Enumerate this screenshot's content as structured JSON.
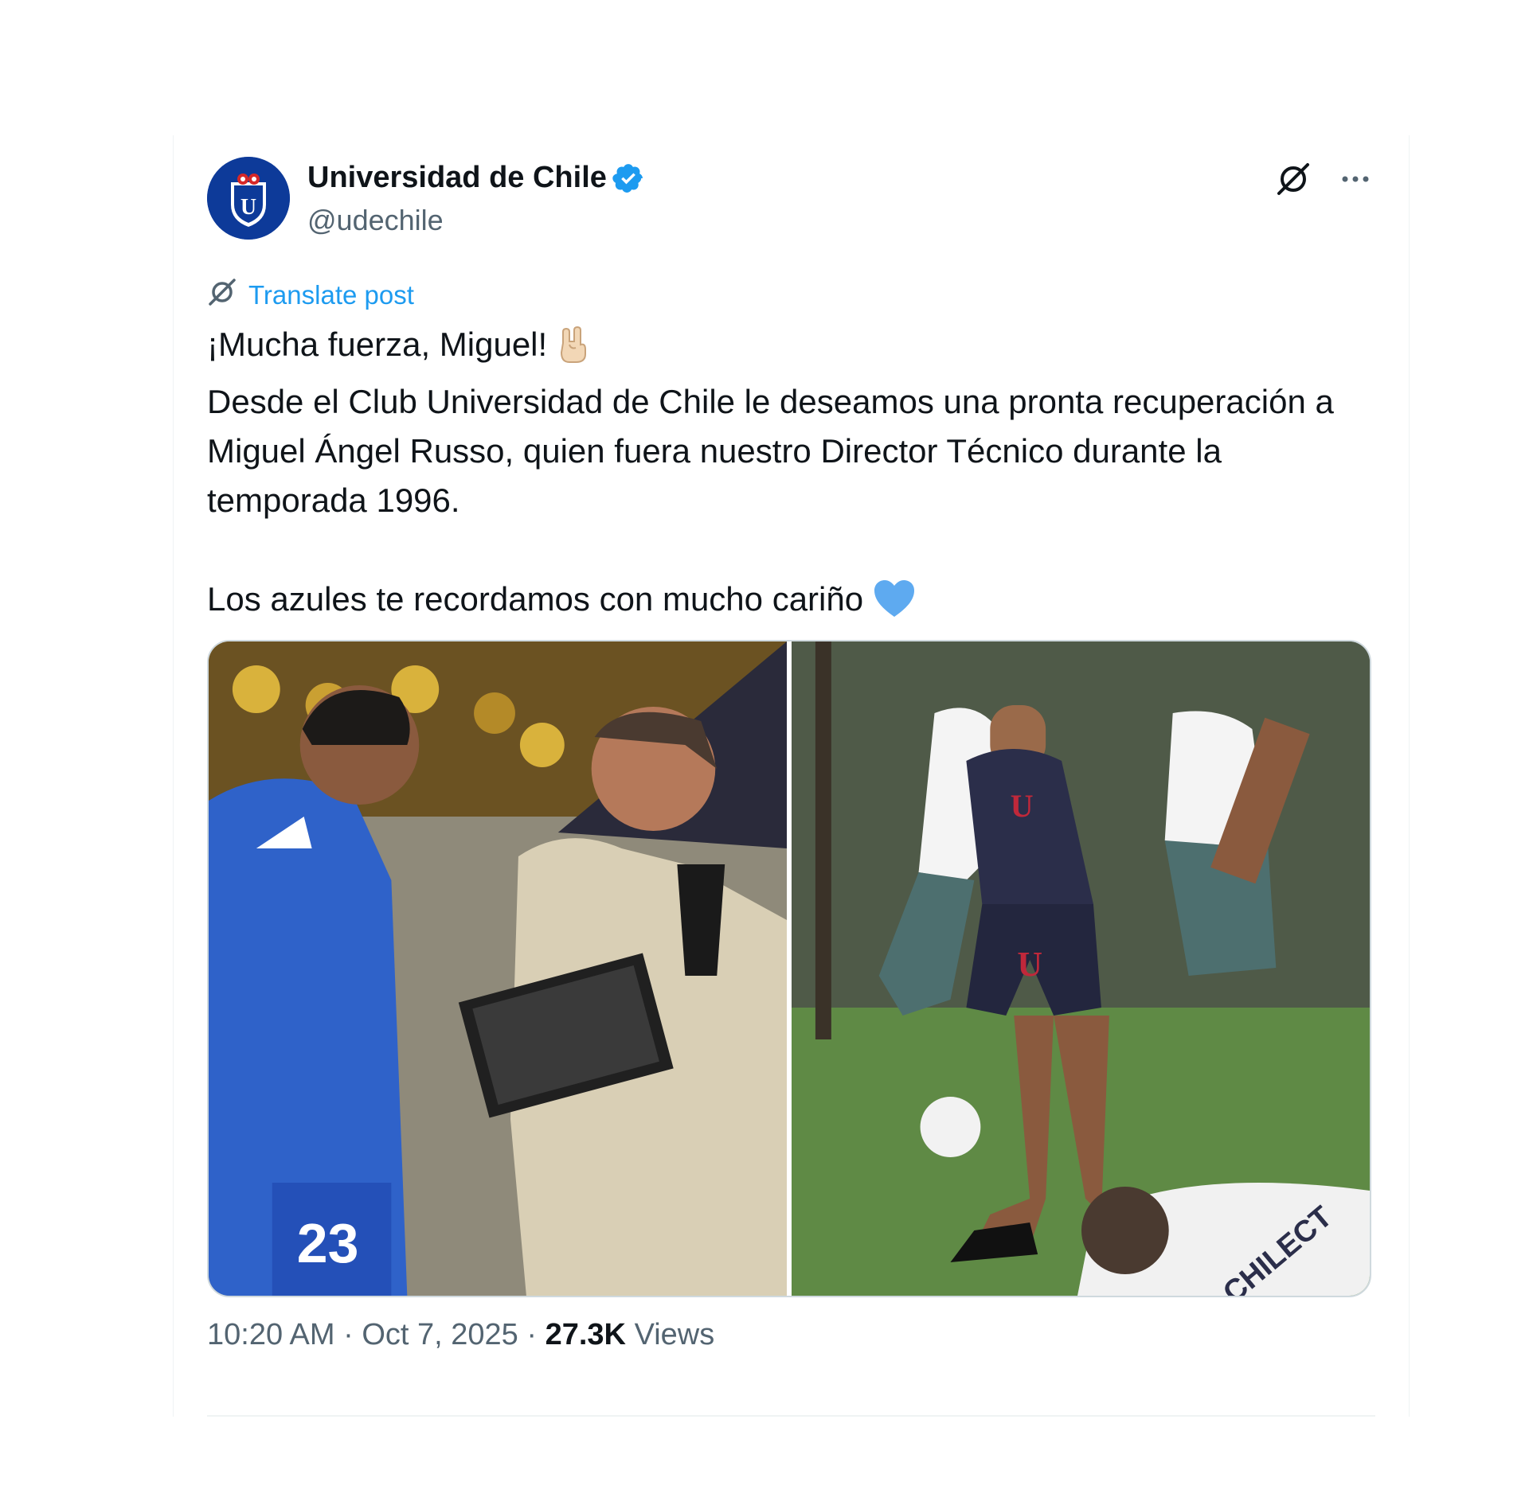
{
  "tweet": {
    "author": {
      "display_name": "Universidad de Chile",
      "handle": "@udechile",
      "verified": true,
      "avatar_icon": "udechile-owl-shield-logo"
    },
    "translate_label": "Translate post",
    "text_lines": [
      "¡Mucha fuerza, Miguel!",
      "Desde el Club Universidad de Chile le deseamos una pronta recuperación a Miguel Ángel Russo, quien fuera nuestro Director Técnico durante la temporada 1996.",
      "Los azules te recordamos con mucho cariño"
    ],
    "emojis": [
      "rock-on-hand-emoji",
      "blue-heart-emoji"
    ],
    "time": "10:20 AM",
    "separator": "·",
    "date": "Oct 7, 2025",
    "views_count": "27.3K",
    "views_label": "Views"
  },
  "icons": {
    "grok": "grok-icon",
    "more": "more-options-icon",
    "translate": "translate-icon",
    "verified": "verified-badge-icon"
  },
  "colors": {
    "accent": "#1d9bf0",
    "text": "#0f1419",
    "secondary": "#536471",
    "club_blue": "#0d3a99"
  }
}
